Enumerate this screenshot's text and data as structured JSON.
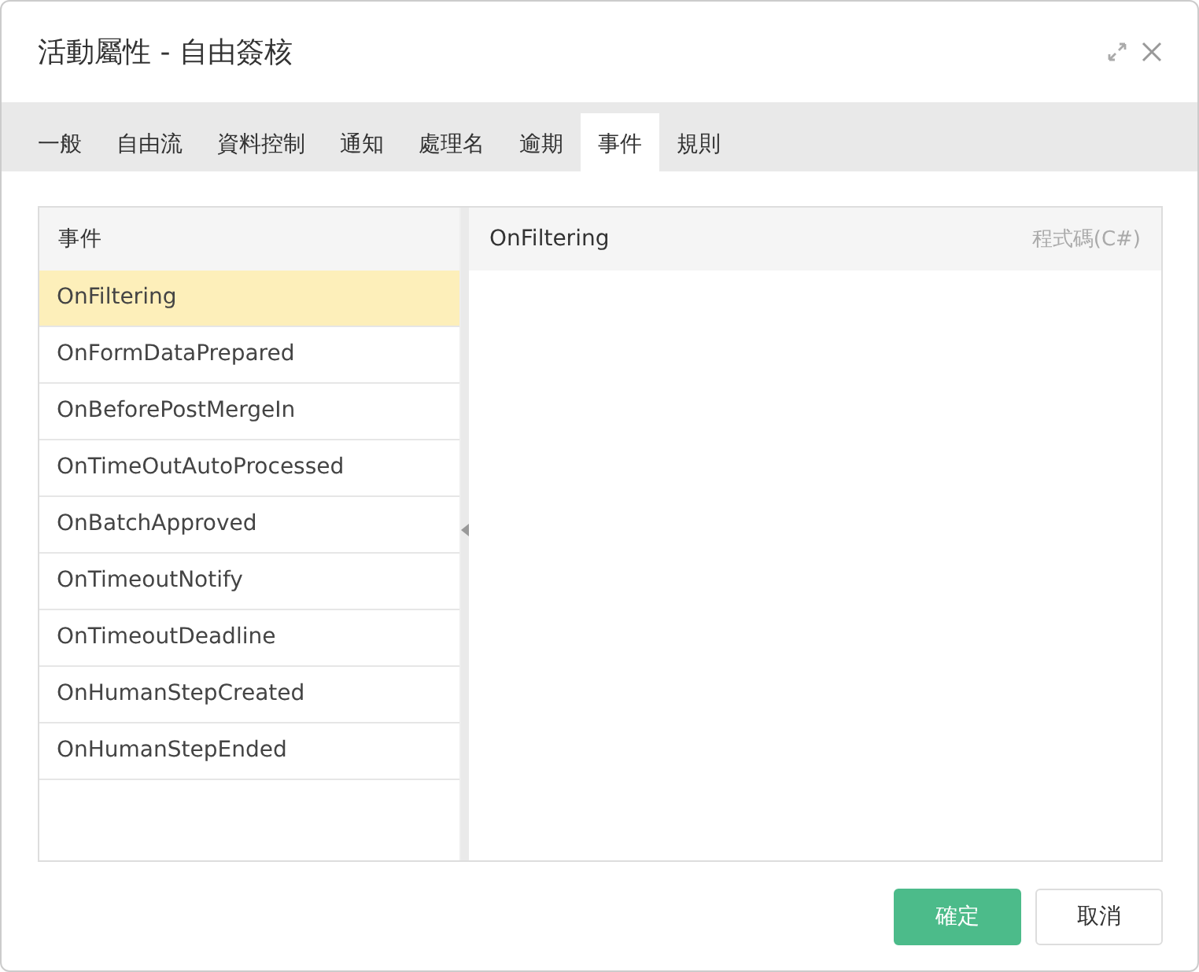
{
  "window": {
    "title": "活動屬性 - 自由簽核"
  },
  "tabs": [
    {
      "label": "一般",
      "selected": false
    },
    {
      "label": "自由流",
      "selected": false
    },
    {
      "label": "資料控制",
      "selected": false
    },
    {
      "label": "通知",
      "selected": false
    },
    {
      "label": "處理名",
      "selected": false
    },
    {
      "label": "逾期",
      "selected": false
    },
    {
      "label": "事件",
      "selected": true
    },
    {
      "label": "規則",
      "selected": false
    }
  ],
  "event_list": {
    "header": "事件",
    "items": [
      {
        "label": "OnFiltering",
        "selected": true
      },
      {
        "label": "OnFormDataPrepared",
        "selected": false
      },
      {
        "label": "OnBeforePostMergeIn",
        "selected": false
      },
      {
        "label": "OnTimeOutAutoProcessed",
        "selected": false
      },
      {
        "label": "OnBatchApproved",
        "selected": false
      },
      {
        "label": "OnTimeoutNotify",
        "selected": false
      },
      {
        "label": "OnTimeoutDeadline",
        "selected": false
      },
      {
        "label": "OnHumanStepCreated",
        "selected": false
      },
      {
        "label": "OnHumanStepEnded",
        "selected": false
      }
    ]
  },
  "code_panel": {
    "title": "OnFiltering",
    "language": "程式碼(C#)"
  },
  "buttons": [
    {
      "label": "確定",
      "kind": "primary"
    },
    {
      "label": "取消",
      "kind": "secondary"
    }
  ]
}
